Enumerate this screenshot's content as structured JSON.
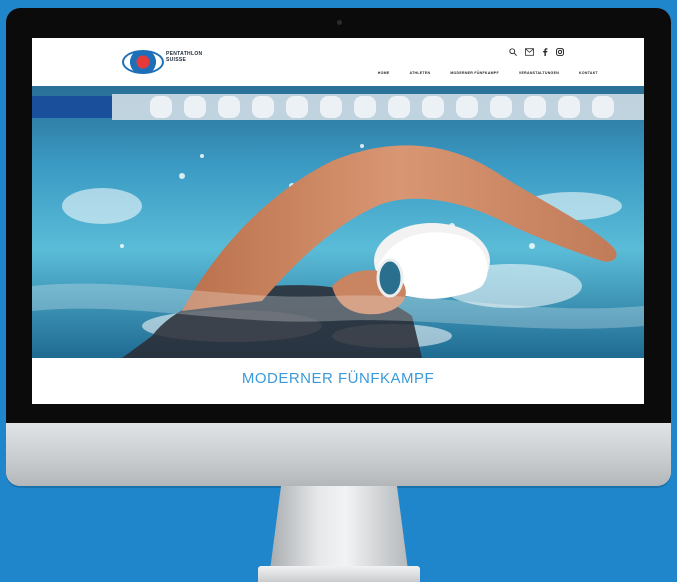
{
  "site": {
    "logo_name": "PENTATHLON\nSUISSE",
    "logo_tagline": "",
    "nav": [
      "HOME",
      "ATHLETEN",
      "MODERNER FÜNFKAMPF",
      "VERANSTALTUNGEN",
      "KONTAKT"
    ],
    "icons": [
      "search-icon",
      "mail-icon",
      "facebook-icon",
      "instagram-icon"
    ],
    "tagline": "MODERNER FÜNFKAMPF"
  },
  "colors": {
    "background": "#1f86cc",
    "tagline": "#3a9ad9",
    "bezel": "#0b0b0c"
  }
}
